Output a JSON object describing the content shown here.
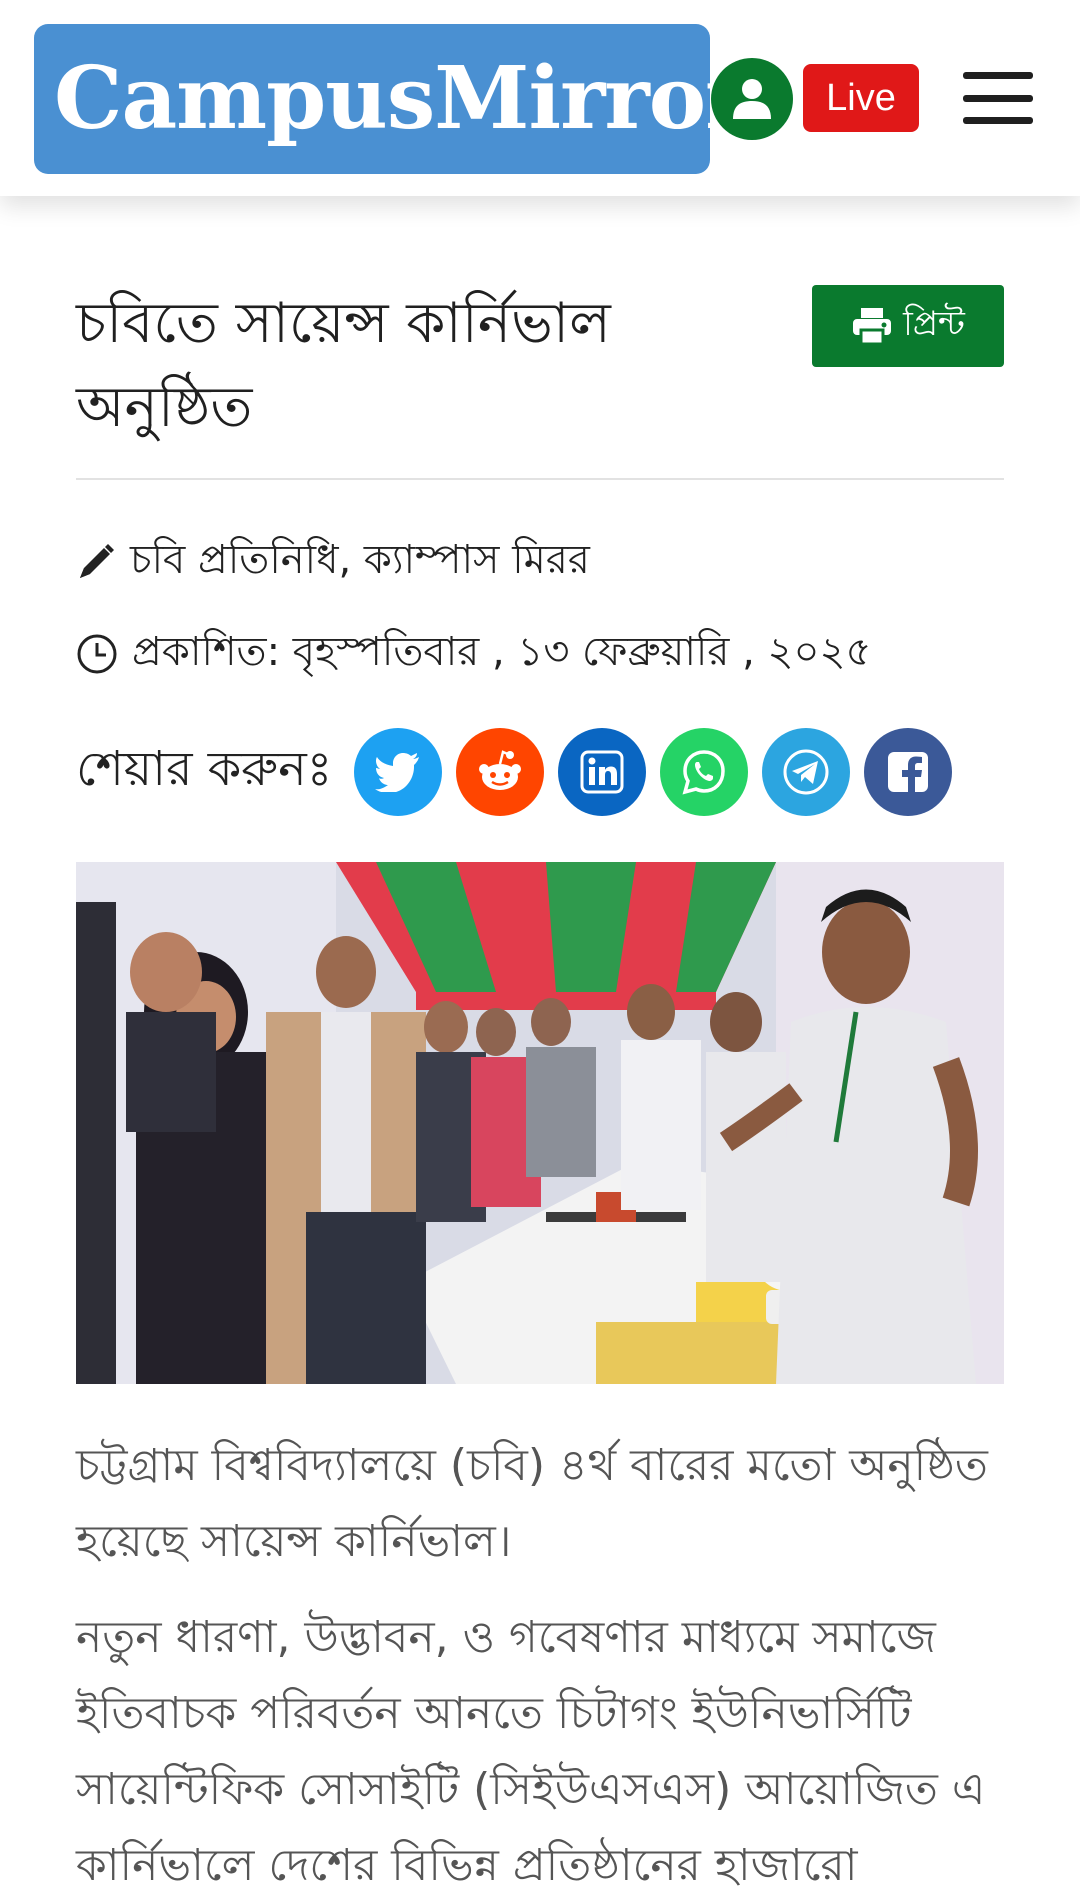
{
  "header": {
    "logo_text": "CampusMirror",
    "live_label": "Live",
    "colors": {
      "logo_bg": "#4a90d2",
      "user_btn": "#0a7a2e",
      "live_btn": "#e01818"
    }
  },
  "article": {
    "title": "চবিতে সায়েন্স কার্নিভাল অনুষ্ঠিত",
    "print_label": "প্রিন্ট",
    "author": "চবি প্রতিনিধি, ক্যাম্পাস মিরর",
    "date": "প্রকাশিত: বৃহস্পতিবার , ১৩ ফেব্রুয়ারি , ২০২৫",
    "share_label": "শেয়ার করুনঃ",
    "share_buttons": [
      {
        "icon": "twitter-icon",
        "color": "#1da1f2"
      },
      {
        "icon": "reddit-icon",
        "color": "#ff4500"
      },
      {
        "icon": "linkedin-icon",
        "color": "#0a66c2"
      },
      {
        "icon": "whatsapp-icon",
        "color": "#25d366"
      },
      {
        "icon": "telegram-icon",
        "color": "#2ca5e0"
      },
      {
        "icon": "facebook-icon",
        "color": "#3b5998"
      }
    ],
    "paragraphs": [
      "চট্টগ্রাম বিশ্ববিদ্যালয়ে (চবি) ৪র্থ বারের মতো অনুষ্ঠিত হয়েছে সায়েন্স কার্নিভাল।",
      " নতুন ধারণা, উদ্ভাবন, ও গবেষণার মাধ্যমে সমাজে ইতিবাচক পরিবর্তন আনতে চিটাগং ইউনিভার্সিটি সায়েন্টিফিক সোসাইটি (সিইউএসএস) আয়োজিত এ কার্নিভালে দেশের বিভিন্ন প্রতিষ্ঠানের হাজারো"
    ]
  }
}
